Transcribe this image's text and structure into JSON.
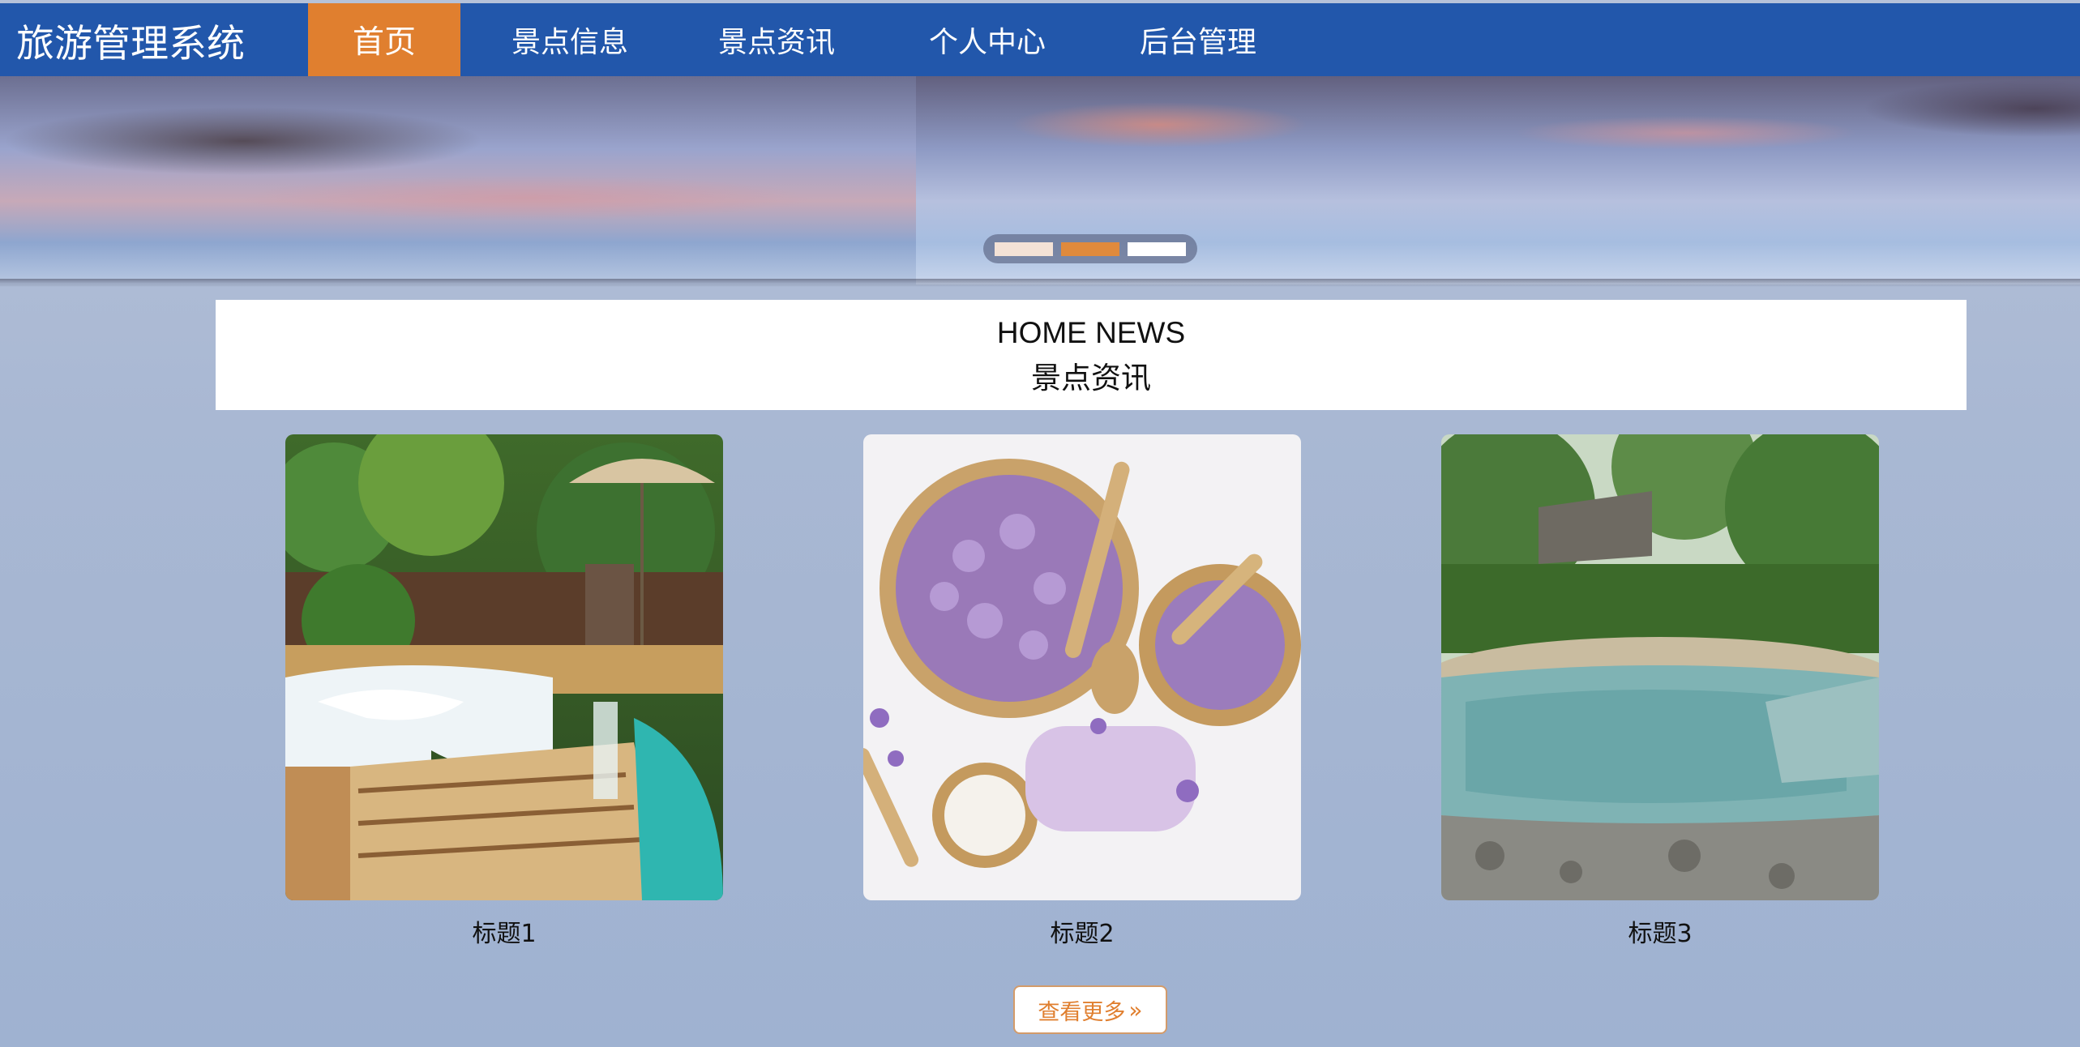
{
  "header": {
    "brand": "旅游管理系统",
    "nav": [
      {
        "label": "首页",
        "active": true
      },
      {
        "label": "景点信息",
        "active": false
      },
      {
        "label": "景点资讯",
        "active": false
      },
      {
        "label": "个人中心",
        "active": false
      },
      {
        "label": "后台管理",
        "active": false
      }
    ],
    "colors": {
      "bar": "#2257ab",
      "active": "#e07f2f"
    }
  },
  "carousel": {
    "slide_count": 3,
    "active_index": 1,
    "indicator_colors": [
      "#f4e2d6",
      "#e08a3c",
      "#ffffff"
    ]
  },
  "news_section": {
    "title_en": "HOME NEWS",
    "title_cn": "景点资讯"
  },
  "cards": [
    {
      "title": "标题1",
      "image": "hot tub with stone edging and umbrella"
    },
    {
      "title": "标题2",
      "image": "bowls of lilac petals and soap"
    },
    {
      "title": "标题3",
      "image": "outdoor stone hot spring pool"
    }
  ],
  "more_button": {
    "label": "查看更多",
    "icon": "double-chevron-right-icon"
  }
}
